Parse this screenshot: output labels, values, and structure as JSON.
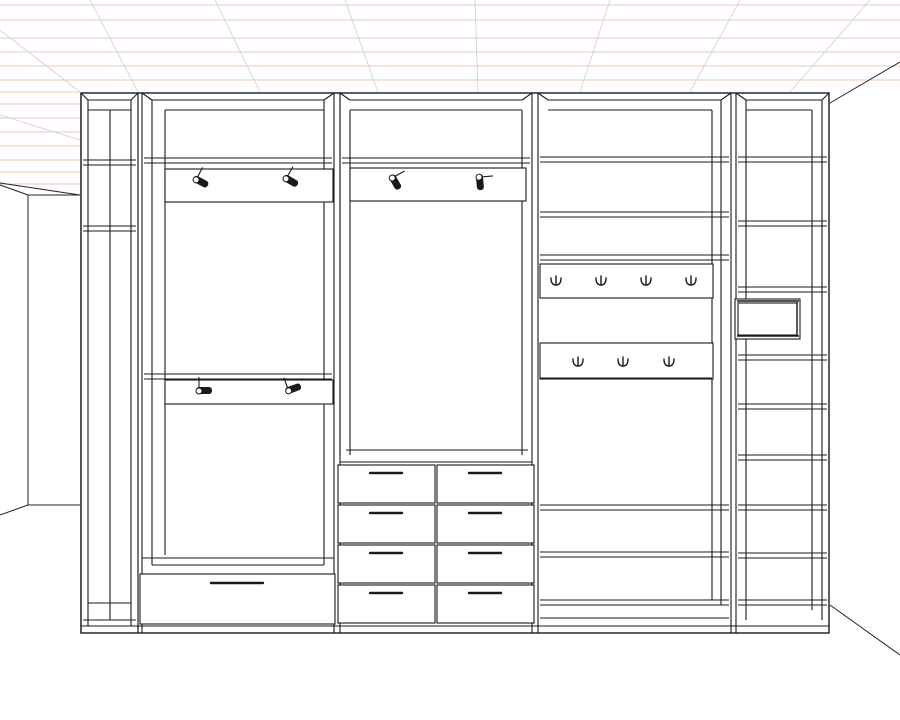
{
  "drawing": {
    "subject": "wardrobe-elevation",
    "line_color": "#1a1a1a",
    "ceiling_grid_color": "#e8b99a",
    "background": "#ffffff",
    "sections": [
      {
        "id": "left-narrow-shelving",
        "items": [
          "shelf",
          "shelf"
        ]
      },
      {
        "id": "hanging-double",
        "items": [
          "rail-bracket",
          "rail-bracket",
          "drawer-wide"
        ]
      },
      {
        "id": "hanging-with-drawers",
        "items": [
          "rail-bracket",
          "drawers-2x4"
        ]
      },
      {
        "id": "shelves-with-hooks",
        "items": [
          "shelf",
          "hook-panel-4",
          "hook-panel-3",
          "shelf",
          "shelf"
        ]
      },
      {
        "id": "right-narrow-shelving",
        "items": [
          "shelf",
          "shelf",
          "appliance-box",
          "shelf",
          "shelf"
        ]
      }
    ]
  }
}
